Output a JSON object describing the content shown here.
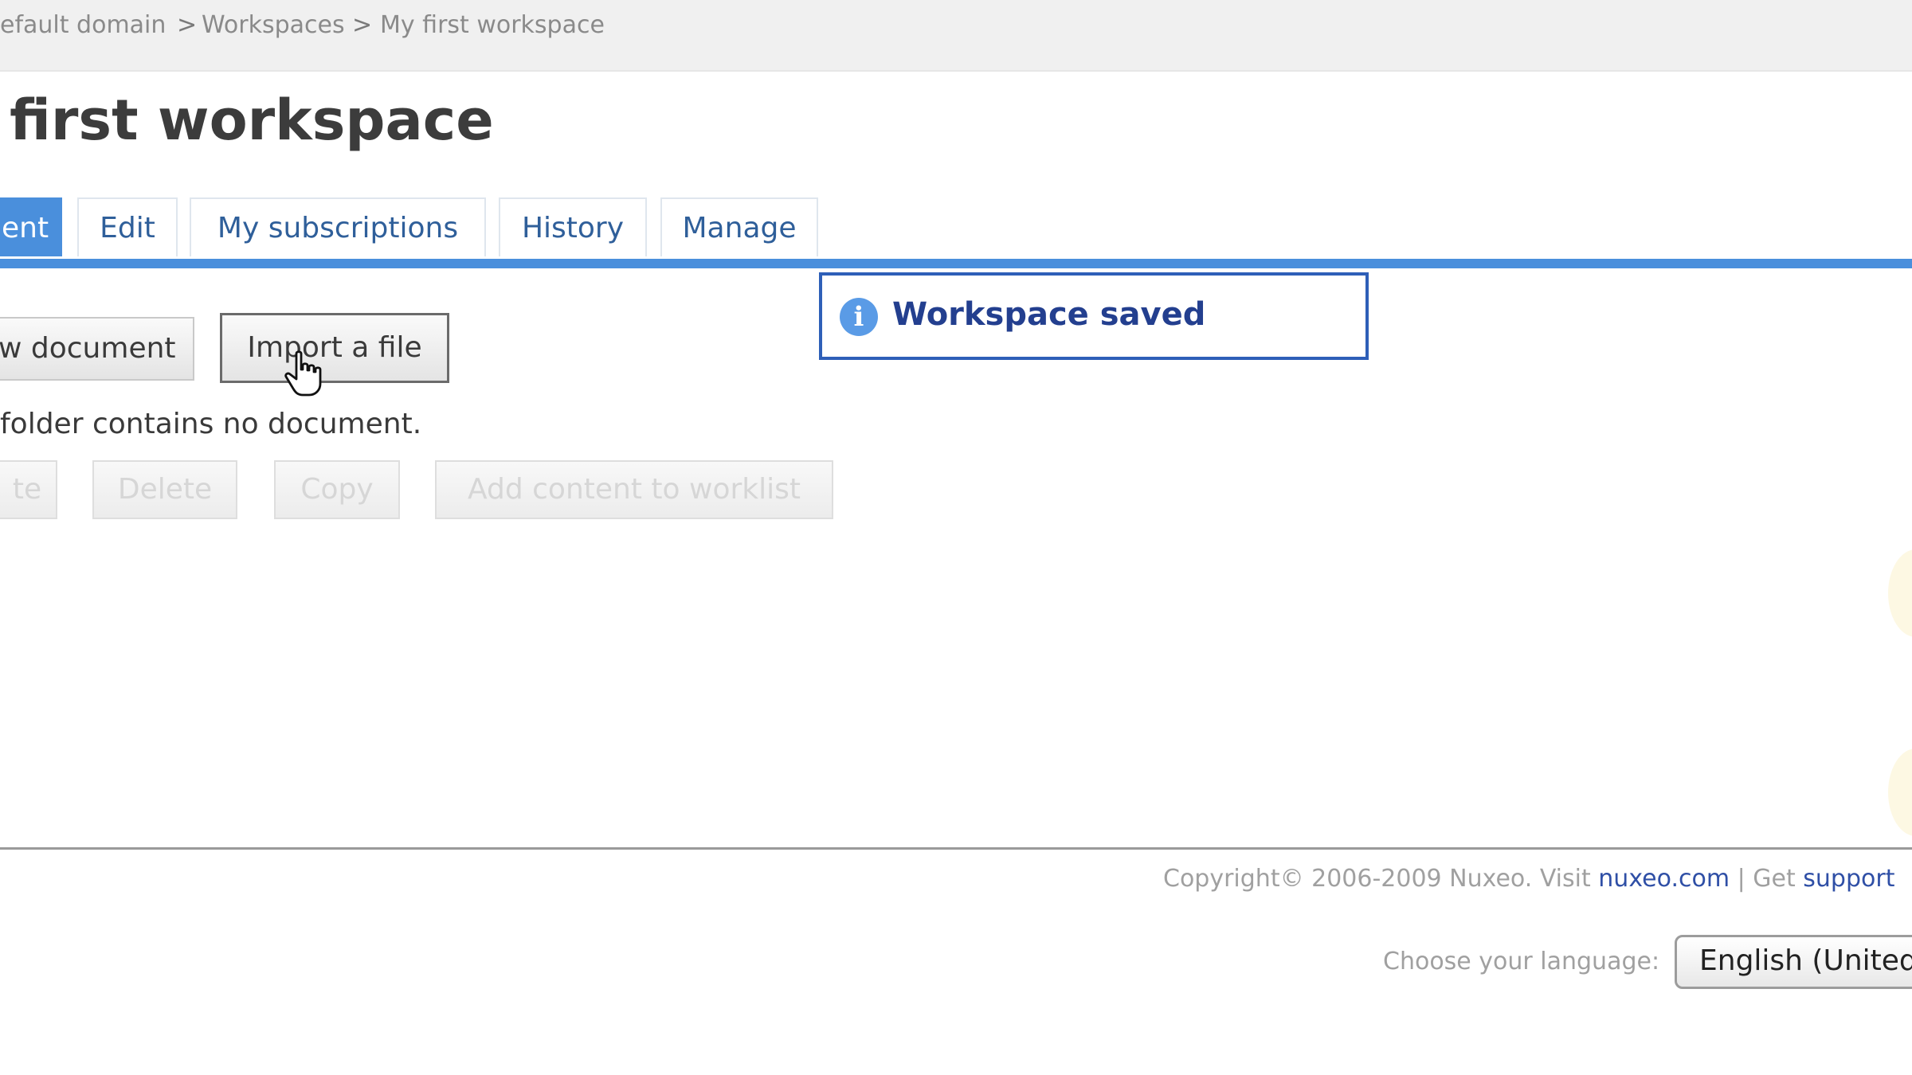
{
  "breadcrumb": {
    "items": [
      "efault domain",
      "Workspaces",
      "My first workspace"
    ],
    "separator": ">"
  },
  "page": {
    "title": "first workspace"
  },
  "tabs": [
    "ent",
    "Edit",
    "My subscriptions",
    "History",
    "Manage"
  ],
  "actions": {
    "new_document": "w document",
    "import_file": "Import a file"
  },
  "content": {
    "empty_message": "folder contains no document."
  },
  "selection_actions": {
    "paste": "te",
    "delete": "Delete",
    "copy": "Copy",
    "add_to_worklist": "Add content to worklist"
  },
  "notification": {
    "icon": "info-icon",
    "text": "Workspace saved"
  },
  "footer": {
    "copyright": "Copyright© 2006-2009 Nuxeo. Visit",
    "link": "nuxeo.com",
    "separator": "|",
    "get": "Get",
    "support_link": "support",
    "language_label": "Choose your language:",
    "language_value": "English (United"
  },
  "colors": {
    "accent": "#4a8fdc",
    "link": "#2f5f9a",
    "notice_border": "#2e5fb8"
  }
}
